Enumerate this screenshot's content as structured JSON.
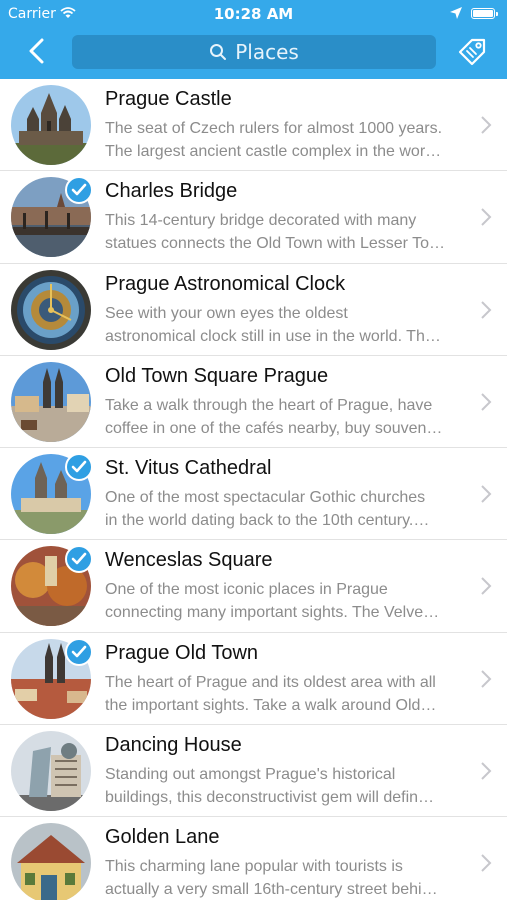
{
  "status_bar": {
    "carrier": "Carrier",
    "time": "10:28 AM"
  },
  "nav": {
    "search_label": "Places",
    "back_icon": "chevron-left-icon",
    "tag_icon": "tag-icon"
  },
  "colors": {
    "nav_bar": "#35a9ea",
    "search_field": "#2a8ec8",
    "checkmark": "#2f9fe3"
  },
  "places": [
    {
      "title": "Prague Castle",
      "desc1": "The seat of Czech rulers for almost 1000 years.",
      "desc2": "The largest ancient castle complex in the wor…",
      "visited": false
    },
    {
      "title": "Charles Bridge",
      "desc1": "This 14-century bridge decorated with many",
      "desc2": "statues connects the Old Town with Lesser To…",
      "visited": true
    },
    {
      "title": "Prague Astronomical Clock",
      "desc1": "See with your own eyes the oldest",
      "desc2": "astronomical clock still in use in the world. Th…",
      "visited": false
    },
    {
      "title": "Old Town Square Prague",
      "desc1": "Take a walk through the heart of Prague, have",
      "desc2": "coffee in one of the cafés nearby, buy souven…",
      "visited": false
    },
    {
      "title": "St. Vitus Cathedral",
      "desc1": "One of the most spectacular Gothic churches",
      "desc2": "in the world dating back to the 10th century.…",
      "visited": true
    },
    {
      "title": "Wenceslas Square",
      "desc1": "One of the most iconic places in Prague",
      "desc2": "connecting many important sights. The Velve…",
      "visited": true
    },
    {
      "title": "Prague Old Town",
      "desc1": "The heart of Prague and its oldest area with all",
      "desc2": "the important sights. Take a walk around Old…",
      "visited": true
    },
    {
      "title": "Dancing House",
      "desc1": "Standing out amongst Prague's historical",
      "desc2": "buildings, this deconstructivist gem will defin…",
      "visited": false
    },
    {
      "title": "Golden Lane",
      "desc1": "This charming lane popular with tourists is",
      "desc2": "actually a very small 16th-century street behi…",
      "visited": false
    }
  ]
}
